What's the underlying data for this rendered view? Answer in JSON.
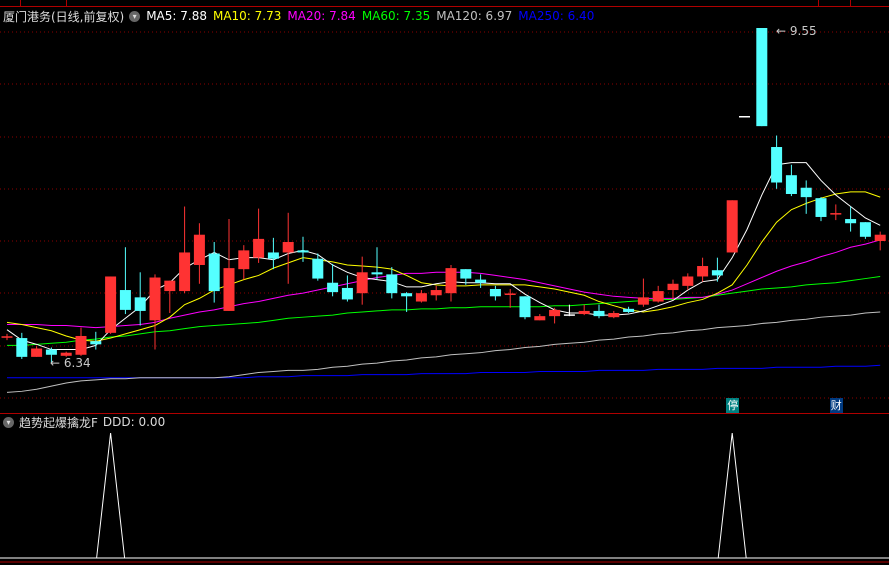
{
  "header": {
    "title": "厦门港务(日线,前复权)",
    "ma_legend": [
      {
        "label": "MA5: 7.88",
        "color": "#ffffff"
      },
      {
        "label": "MA10: 7.73",
        "color": "#ffff00"
      },
      {
        "label": "MA20: 7.84",
        "color": "#ff00ff"
      },
      {
        "label": "MA60: 7.35",
        "color": "#00ff00"
      },
      {
        "label": "MA120: 6.97",
        "color": "#c0c0c0"
      },
      {
        "label": "MA250: 6.40",
        "color": "#0000ff"
      }
    ]
  },
  "indicator": {
    "title": "趋势起爆擒龙F",
    "value_label": "DDD: 0.00",
    "values": [
      0,
      0,
      0,
      0,
      0,
      0,
      0,
      1,
      0,
      0,
      0,
      0,
      0,
      0,
      0,
      0,
      0,
      0,
      0,
      0,
      0,
      0,
      0,
      0,
      0,
      0,
      0,
      0,
      0,
      0,
      0,
      0,
      0,
      0,
      0,
      0,
      0,
      0,
      0,
      0,
      0,
      0,
      0,
      0,
      0,
      0,
      0,
      0,
      0,
      1,
      0,
      0,
      0,
      0,
      0,
      0,
      0,
      0,
      0,
      0
    ]
  },
  "annotations": {
    "high_label": "9.55",
    "low_label": "6.34"
  },
  "markers": [
    {
      "label": "停",
      "index": 49,
      "color": "#008080"
    },
    {
      "label": "财",
      "index": 56,
      "color": "#003a80"
    }
  ],
  "colors": {
    "up": "#ff3333",
    "down": "#54ffff",
    "grid": "#8b0000",
    "border": "#b00000"
  },
  "chart_data": {
    "type": "candlestick",
    "candles": [
      [
        6.59,
        6.59,
        6.62,
        6.56
      ],
      [
        6.58,
        6.4,
        6.63,
        6.38
      ],
      [
        6.4,
        6.48,
        6.5,
        6.4
      ],
      [
        6.47,
        6.42,
        6.49,
        6.34
      ],
      [
        6.41,
        6.44,
        6.45,
        6.4
      ],
      [
        6.42,
        6.6,
        6.68,
        6.41
      ],
      [
        6.55,
        6.52,
        6.64,
        6.47
      ],
      [
        6.63,
        7.17,
        7.17,
        6.62
      ],
      [
        7.04,
        6.85,
        7.45,
        6.81
      ],
      [
        6.97,
        6.84,
        7.21,
        6.7
      ],
      [
        6.75,
        7.16,
        7.19,
        6.47
      ],
      [
        7.03,
        7.13,
        7.13,
        6.82
      ],
      [
        7.03,
        7.4,
        7.84,
        7.01
      ],
      [
        7.28,
        7.57,
        7.68,
        7.1
      ],
      [
        7.39,
        7.03,
        7.5,
        6.92
      ],
      [
        6.84,
        7.25,
        7.72,
        6.84
      ],
      [
        7.24,
        7.42,
        7.47,
        7.14
      ],
      [
        7.35,
        7.53,
        7.82,
        7.3
      ],
      [
        7.4,
        7.34,
        7.54,
        7.24
      ],
      [
        7.4,
        7.5,
        7.78,
        7.1
      ],
      [
        7.42,
        7.4,
        7.55,
        7.31
      ],
      [
        7.34,
        7.15,
        7.39,
        7.13
      ],
      [
        7.11,
        7.02,
        7.29,
        6.98
      ],
      [
        7.06,
        6.95,
        7.18,
        6.93
      ],
      [
        7.01,
        7.21,
        7.36,
        6.9
      ],
      [
        7.21,
        7.19,
        7.45,
        7.14
      ],
      [
        7.19,
        7.01,
        7.26,
        6.96
      ],
      [
        7.01,
        6.98,
        7.02,
        6.83
      ],
      [
        6.93,
        7.01,
        7.04,
        6.92
      ],
      [
        6.99,
        7.04,
        7.08,
        6.94
      ],
      [
        7.01,
        7.25,
        7.28,
        6.93
      ],
      [
        7.24,
        7.15,
        7.24,
        7.09
      ],
      [
        7.14,
        7.11,
        7.19,
        7.06
      ],
      [
        7.05,
        6.98,
        7.08,
        6.94
      ],
      [
        6.99,
        7.0,
        7.05,
        6.87
      ],
      [
        6.98,
        6.78,
        6.98,
        6.76
      ],
      [
        6.75,
        6.79,
        6.81,
        6.75
      ],
      [
        6.79,
        6.85,
        6.87,
        6.72
      ],
      [
        6.8,
        6.8,
        6.9,
        6.79
      ],
      [
        6.81,
        6.84,
        6.9,
        6.8
      ],
      [
        6.84,
        6.79,
        6.9,
        6.77
      ],
      [
        6.78,
        6.82,
        6.84,
        6.77
      ],
      [
        6.86,
        6.83,
        6.88,
        6.82
      ],
      [
        6.9,
        6.97,
        7.15,
        6.88
      ],
      [
        6.93,
        7.03,
        7.08,
        6.92
      ],
      [
        7.04,
        7.1,
        7.14,
        6.95
      ],
      [
        7.08,
        7.17,
        7.2,
        7.04
      ],
      [
        7.17,
        7.27,
        7.35,
        7.12
      ],
      [
        7.23,
        7.18,
        7.35,
        7.12
      ],
      [
        7.4,
        7.9,
        7.9,
        7.4
      ],
      [
        8.7,
        8.7,
        8.7,
        8.7
      ],
      [
        9.55,
        8.61,
        9.55,
        8.61
      ],
      [
        8.41,
        8.07,
        8.52,
        8.01
      ],
      [
        8.14,
        7.96,
        8.24,
        7.94
      ],
      [
        8.02,
        7.93,
        8.09,
        7.77
      ],
      [
        7.92,
        7.74,
        7.93,
        7.7
      ],
      [
        7.77,
        7.77,
        7.86,
        7.71
      ],
      [
        7.72,
        7.68,
        7.84,
        7.6
      ],
      [
        7.69,
        7.55,
        7.69,
        7.53
      ],
      [
        7.51,
        7.57,
        7.6,
        7.42
      ]
    ],
    "candle_fields": [
      "open",
      "close",
      "high",
      "low"
    ],
    "series": [
      {
        "name": "MA5",
        "color": "#ffffff",
        "values": [
          6.66,
          6.56,
          6.52,
          6.47,
          6.47,
          6.47,
          6.51,
          6.66,
          6.77,
          6.88,
          7.04,
          7.11,
          7.25,
          7.33,
          7.4,
          7.33,
          7.35,
          7.35,
          7.33,
          7.39,
          7.42,
          7.38,
          7.28,
          7.21,
          7.16,
          7.14,
          7.12,
          7.07,
          7.07,
          7.1,
          7.12,
          7.11,
          7.11,
          7.1,
          7.1,
          7.0,
          6.92,
          6.85,
          6.82,
          6.82,
          6.8,
          6.8,
          6.81,
          6.84,
          6.89,
          6.94,
          7.04,
          7.12,
          7.14,
          7.35,
          7.62,
          7.95,
          8.24,
          8.26,
          8.26,
          8.09,
          7.95,
          7.84,
          7.73,
          7.66
        ]
      },
      {
        "name": "MA10",
        "color": "#ffff00",
        "values": [
          6.73,
          6.71,
          6.68,
          6.65,
          6.6,
          6.56,
          6.55,
          6.58,
          6.62,
          6.66,
          6.7,
          6.78,
          6.9,
          6.96,
          7.04,
          7.09,
          7.14,
          7.18,
          7.25,
          7.3,
          7.35,
          7.33,
          7.31,
          7.28,
          7.27,
          7.26,
          7.24,
          7.18,
          7.11,
          7.09,
          7.08,
          7.08,
          7.09,
          7.09,
          7.09,
          7.09,
          7.07,
          7.05,
          7.02,
          6.99,
          6.93,
          6.89,
          6.85,
          6.83,
          6.85,
          6.88,
          6.92,
          6.95,
          7.01,
          7.09,
          7.28,
          7.5,
          7.69,
          7.81,
          7.87,
          7.92,
          7.96,
          7.98,
          7.98,
          7.93
        ]
      },
      {
        "name": "MA20",
        "color": "#ff00ff",
        "values": [
          6.71,
          6.71,
          6.71,
          6.7,
          6.7,
          6.69,
          6.68,
          6.69,
          6.7,
          6.71,
          6.73,
          6.77,
          6.8,
          6.83,
          6.85,
          6.88,
          6.91,
          6.93,
          6.96,
          6.99,
          7.01,
          7.04,
          7.07,
          7.1,
          7.13,
          7.16,
          7.18,
          7.2,
          7.2,
          7.21,
          7.21,
          7.21,
          7.2,
          7.18,
          7.16,
          7.14,
          7.11,
          7.08,
          7.05,
          7.02,
          7.0,
          6.98,
          6.97,
          6.96,
          6.96,
          6.96,
          6.97,
          6.97,
          7.0,
          7.04,
          7.1,
          7.16,
          7.22,
          7.27,
          7.31,
          7.36,
          7.4,
          7.45,
          7.48,
          7.52
        ]
      },
      {
        "name": "MA60",
        "color": "#00ff00",
        "values": [
          6.51,
          6.51,
          6.52,
          6.53,
          6.54,
          6.56,
          6.57,
          6.59,
          6.6,
          6.62,
          6.64,
          6.65,
          6.67,
          6.69,
          6.7,
          6.71,
          6.72,
          6.73,
          6.75,
          6.77,
          6.78,
          6.79,
          6.8,
          6.82,
          6.83,
          6.84,
          6.85,
          6.85,
          6.86,
          6.86,
          6.87,
          6.87,
          6.88,
          6.88,
          6.88,
          6.88,
          6.88,
          6.89,
          6.89,
          6.9,
          6.91,
          6.92,
          6.93,
          6.94,
          6.95,
          6.95,
          6.96,
          6.97,
          6.99,
          7.01,
          7.03,
          7.05,
          7.06,
          7.07,
          7.09,
          7.1,
          7.11,
          7.13,
          7.15,
          7.17
        ]
      },
      {
        "name": "MA120",
        "color": "#c0c0c0",
        "values": [
          6.06,
          6.07,
          6.09,
          6.12,
          6.15,
          6.17,
          6.18,
          6.19,
          6.19,
          6.2,
          6.2,
          6.2,
          6.2,
          6.2,
          6.2,
          6.21,
          6.23,
          6.25,
          6.26,
          6.27,
          6.27,
          6.28,
          6.3,
          6.31,
          6.33,
          6.34,
          6.36,
          6.37,
          6.39,
          6.4,
          6.42,
          6.43,
          6.44,
          6.46,
          6.47,
          6.49,
          6.5,
          6.52,
          6.53,
          6.54,
          6.56,
          6.57,
          6.59,
          6.6,
          6.62,
          6.63,
          6.65,
          6.66,
          6.68,
          6.69,
          6.7,
          6.72,
          6.73,
          6.75,
          6.76,
          6.78,
          6.79,
          6.8,
          6.82,
          6.83
        ]
      },
      {
        "name": "MA250",
        "color": "#0000ff",
        "values": [
          6.2,
          6.2,
          6.2,
          6.2,
          6.2,
          6.2,
          6.2,
          6.2,
          6.2,
          6.2,
          6.2,
          6.2,
          6.2,
          6.2,
          6.2,
          6.2,
          6.2,
          6.21,
          6.21,
          6.21,
          6.22,
          6.22,
          6.22,
          6.22,
          6.23,
          6.23,
          6.23,
          6.23,
          6.24,
          6.24,
          6.24,
          6.24,
          6.25,
          6.25,
          6.25,
          6.25,
          6.26,
          6.26,
          6.26,
          6.26,
          6.27,
          6.27,
          6.27,
          6.27,
          6.28,
          6.28,
          6.28,
          6.28,
          6.29,
          6.29,
          6.29,
          6.29,
          6.3,
          6.3,
          6.3,
          6.3,
          6.31,
          6.31,
          6.31,
          6.32
        ]
      }
    ]
  }
}
